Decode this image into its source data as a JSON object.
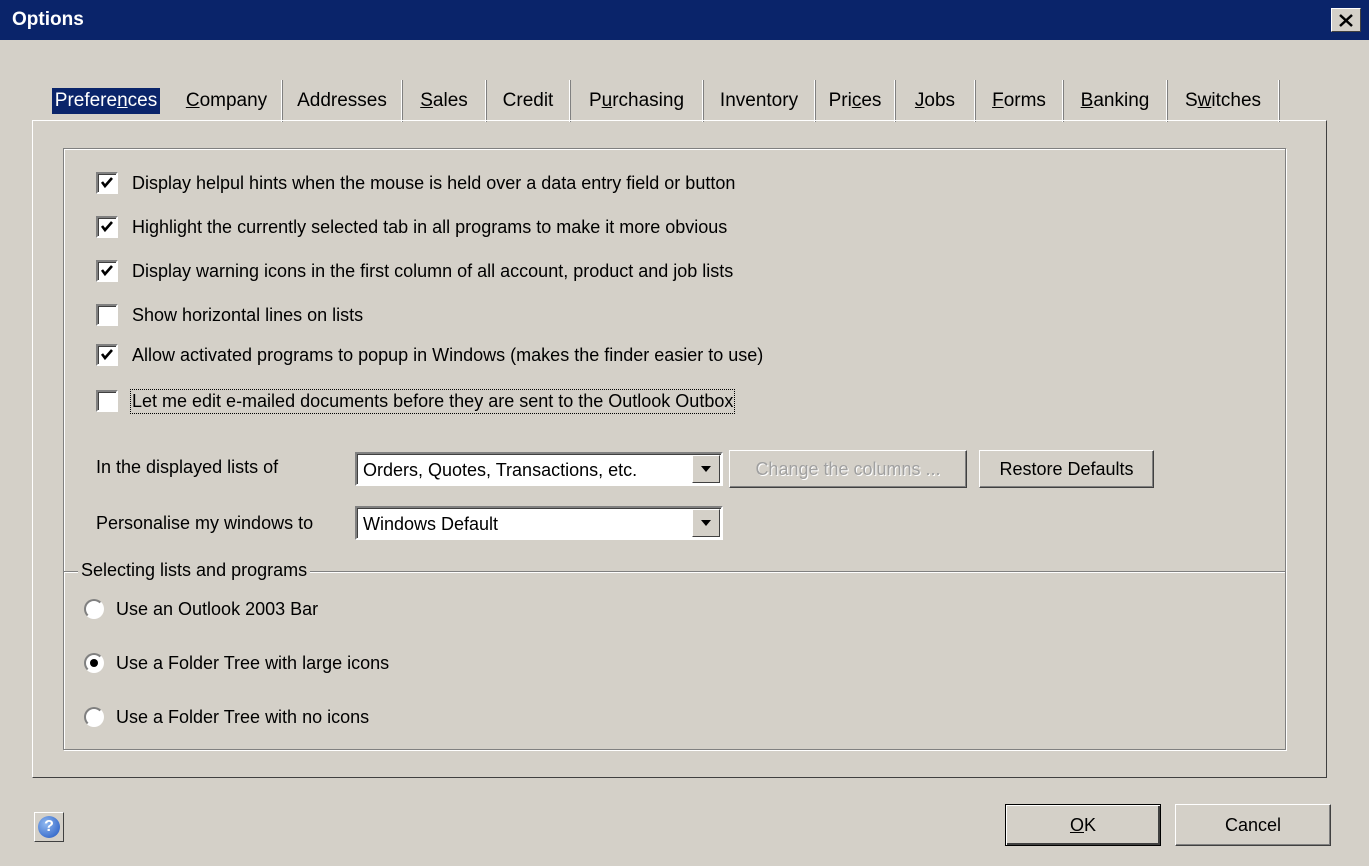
{
  "window": {
    "title": "Options"
  },
  "tabs": [
    {
      "label": "Preferences",
      "key": "n",
      "active": true
    },
    {
      "label": "Company",
      "key": "C"
    },
    {
      "label": "Addresses"
    },
    {
      "label": "Sales",
      "key": "S"
    },
    {
      "label": "Credit"
    },
    {
      "label": "Purchasing",
      "key": "u"
    },
    {
      "label": "Inventory"
    },
    {
      "label": "Prices",
      "key": "c"
    },
    {
      "label": "Jobs",
      "key": "J"
    },
    {
      "label": "Forms",
      "key": "F"
    },
    {
      "label": "Banking",
      "key": "B"
    },
    {
      "label": "Switches",
      "key": "w"
    }
  ],
  "preferences": {
    "checkboxes": [
      {
        "label": "Display helpul hints when the mouse is held over a data entry field or button",
        "checked": true
      },
      {
        "label": "Highlight the currently selected tab in all programs to make it more obvious",
        "checked": true
      },
      {
        "label": "Display warning icons in the first column of all account, product and job lists",
        "checked": true
      },
      {
        "label": "Show horizontal lines on lists",
        "checked": false
      },
      {
        "label": "Allow activated programs to popup in Windows (makes the finder easier to use)",
        "checked": true
      },
      {
        "label": "Let me edit e-mailed documents before they are sent to the Outlook Outbox",
        "checked": false
      }
    ],
    "lists_label": "In the displayed lists of",
    "lists_value": "Orders, Quotes, Transactions, etc.",
    "change_columns_label": "Change the columns ...",
    "restore_defaults_label": "Restore Defaults",
    "personalise_label": "Personalise my windows to",
    "personalise_value": "Windows Default"
  },
  "selecting": {
    "legend": "Selecting lists and programs",
    "options": [
      {
        "label": "Use an Outlook 2003 Bar",
        "selected": false
      },
      {
        "label": "Use a Folder Tree with large icons",
        "selected": true
      },
      {
        "label": "Use a Folder Tree with no icons",
        "selected": false
      }
    ]
  },
  "footer": {
    "ok_label": "OK",
    "cancel_label": "Cancel",
    "help_glyph": "?"
  }
}
